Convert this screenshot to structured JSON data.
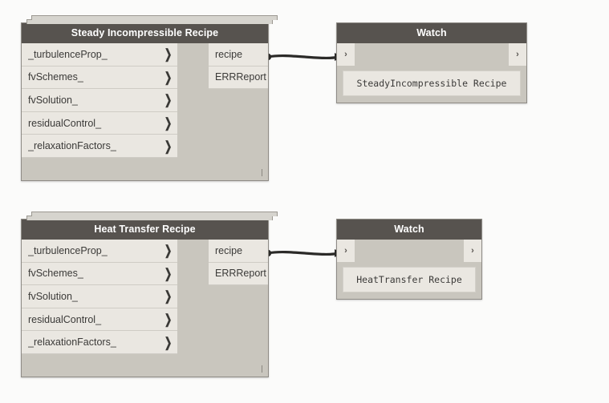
{
  "canvas": {
    "background_color": "#fbfbfa",
    "header_color": "#57534f",
    "node_body_color": "#c9c6be",
    "port_color": "#eae7e1",
    "wire_color": "#2b2a28"
  },
  "icons": {
    "chevron_right": "❯",
    "port_arrow": "›"
  },
  "nodes": [
    {
      "id": "steady-incompressible-recipe",
      "kind": "custom-node",
      "title": "Steady Incompressible Recipe",
      "inputs": [
        {
          "label": "_turbulenceProp_"
        },
        {
          "label": "fvSchemes_"
        },
        {
          "label": "fvSolution_"
        },
        {
          "label": "residualControl_"
        },
        {
          "label": "_relaxationFactors_"
        }
      ],
      "outputs": [
        {
          "label": "recipe"
        },
        {
          "label": "ERRReport"
        }
      ]
    },
    {
      "id": "watch-steady-incompressible",
      "kind": "watch",
      "title": "Watch",
      "input_port": "›",
      "output_port": "›",
      "value": "SteadyIncompressible Recipe"
    },
    {
      "id": "heat-transfer-recipe",
      "kind": "custom-node",
      "title": "Heat Transfer Recipe",
      "inputs": [
        {
          "label": "_turbulenceProp_"
        },
        {
          "label": "fvSchemes_"
        },
        {
          "label": "fvSolution_"
        },
        {
          "label": "residualControl_"
        },
        {
          "label": "_relaxationFactors_"
        }
      ],
      "outputs": [
        {
          "label": "recipe"
        },
        {
          "label": "ERRReport"
        }
      ]
    },
    {
      "id": "watch-heat-transfer",
      "kind": "watch",
      "title": "Watch",
      "input_port": "›",
      "output_port": "›",
      "value": "HeatTransfer Recipe"
    }
  ]
}
